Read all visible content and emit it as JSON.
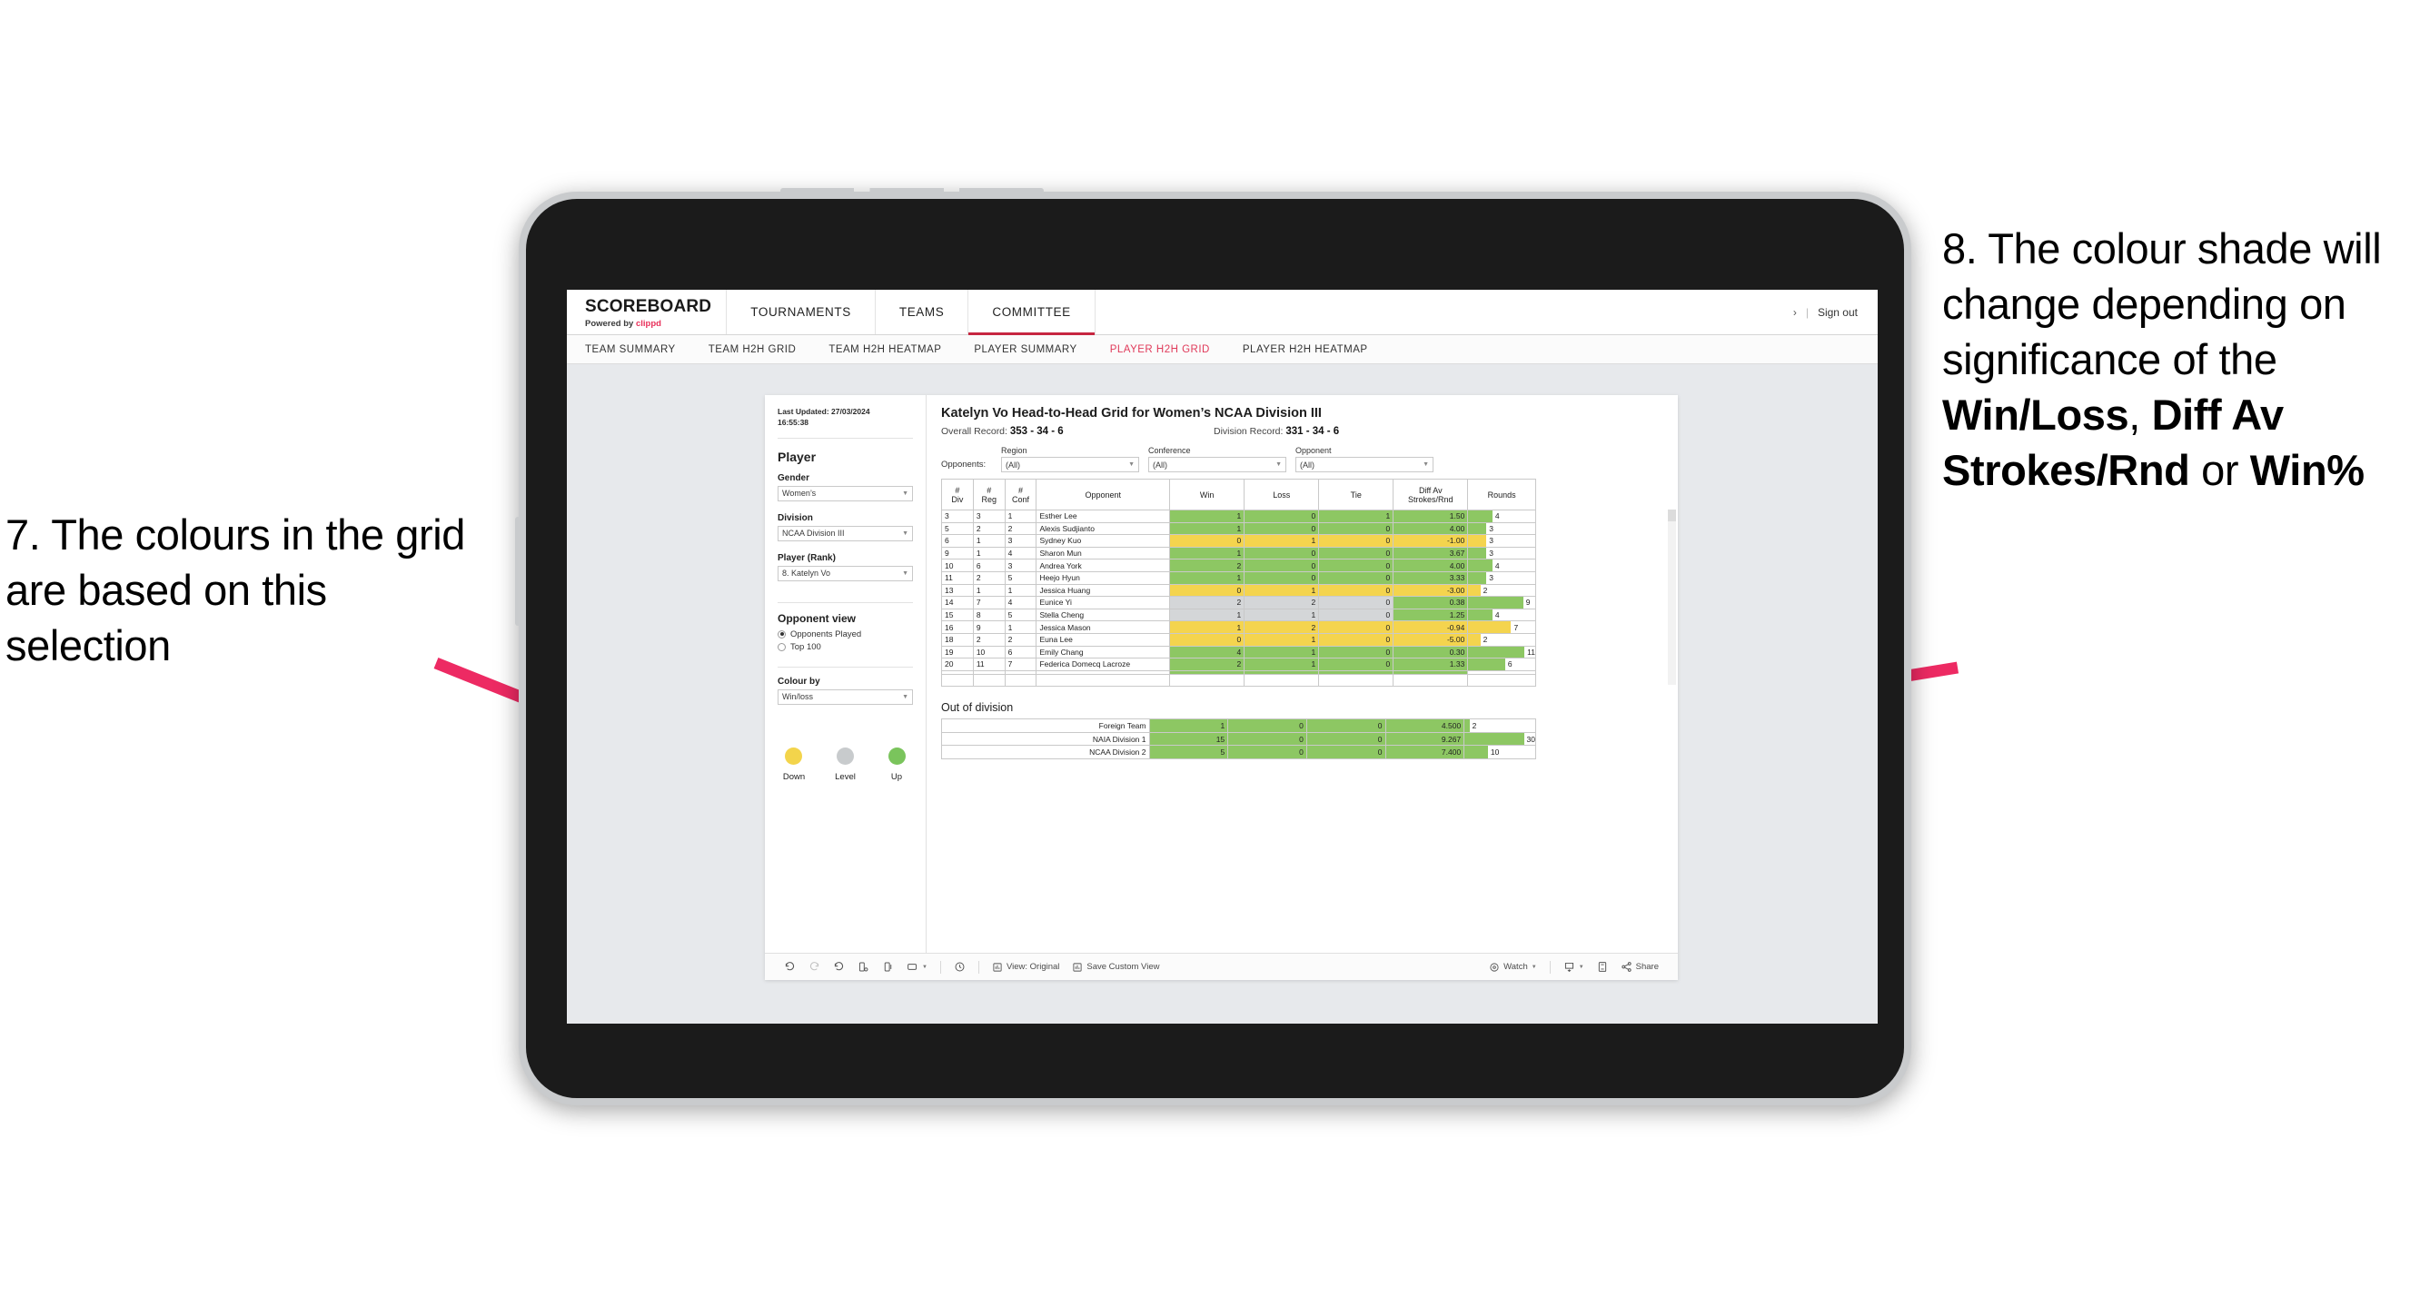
{
  "annotations": {
    "left": {
      "id": "7.",
      "text": "7. The colours in the grid are based on this selection"
    },
    "right": {
      "id": "8.",
      "line1": "8. The colour shade will change depending on significance of the ",
      "bold1": "Win/Loss",
      "mid1": ", ",
      "bold2": "Diff Av Strokes/Rnd",
      "mid2": " or ",
      "bold3": "Win%"
    },
    "arrow_color": "#ed2a63"
  },
  "app": {
    "brand": {
      "title": "SCOREBOARD",
      "powered_prefix": "Powered by ",
      "powered_name": "clippd"
    },
    "top_nav": [
      {
        "label": "TOURNAMENTS",
        "active": false
      },
      {
        "label": "TEAMS",
        "active": false
      },
      {
        "label": "COMMITTEE",
        "active": true
      }
    ],
    "top_right": {
      "chevron": "›",
      "separator": "|",
      "sign_out": "Sign out"
    },
    "sub_nav": [
      {
        "label": "TEAM SUMMARY",
        "active": false
      },
      {
        "label": "TEAM H2H GRID",
        "active": false
      },
      {
        "label": "TEAM H2H HEATMAP",
        "active": false
      },
      {
        "label": "PLAYER SUMMARY",
        "active": false
      },
      {
        "label": "PLAYER H2H GRID",
        "active": true
      },
      {
        "label": "PLAYER H2H HEATMAP",
        "active": false
      }
    ],
    "accent_color": "#e03a5a"
  },
  "pane": {
    "last_updated": "Last Updated: 27/03/2024\n16:55:38",
    "heading": "Player",
    "gender": {
      "label": "Gender",
      "value": "Women’s"
    },
    "division": {
      "label": "Division",
      "value": "NCAA Division III"
    },
    "player_rank": {
      "label": "Player (Rank)",
      "value": "8. Katelyn Vo"
    },
    "opponent_view": {
      "heading": "Opponent view",
      "options": [
        {
          "label": "Opponents Played",
          "selected": true
        },
        {
          "label": "Top 100",
          "selected": false
        }
      ]
    },
    "colour_by": {
      "label": "Colour by",
      "value": "Win/loss"
    },
    "legend": {
      "items": [
        {
          "label": "Down",
          "color": "#f3d44b"
        },
        {
          "label": "Level",
          "color": "#c8cbcd"
        },
        {
          "label": "Up",
          "color": "#7ac45c"
        }
      ]
    }
  },
  "main": {
    "title": "Katelyn Vo Head-to-Head Grid for Women’s NCAA Division III",
    "overall_record_label": "Overall Record: ",
    "overall_record_value": "353 - 34 - 6",
    "division_record_label": "Division Record: ",
    "division_record_value": "331 - 34 - 6",
    "opponents_label": "Opponents:",
    "filters": [
      {
        "label": "Region",
        "value": "(All)"
      },
      {
        "label": "Conference",
        "value": "(All)"
      },
      {
        "label": "Opponent",
        "value": "(All)"
      }
    ]
  },
  "chart_data": {
    "type": "table",
    "title": "Katelyn Vo Head-to-Head Grid for Women’s NCAA Division III",
    "columns": [
      "# Div",
      "# Reg",
      "# Conf",
      "Opponent",
      "Win",
      "Loss",
      "Tie",
      "Diff Av Strokes/Rnd",
      "Rounds"
    ],
    "column_headers_multiline": [
      [
        "#",
        "Div"
      ],
      [
        "#",
        "Reg"
      ],
      [
        "#",
        "Conf"
      ],
      [
        "Opponent"
      ],
      [
        "Win"
      ],
      [
        "Loss"
      ],
      [
        "Tie"
      ],
      [
        "Diff Av",
        "Strokes/Rnd"
      ],
      [
        "Rounds"
      ]
    ],
    "colors": {
      "up": "#8dc763",
      "down": "#f4d44e",
      "level": "#d4d6d8",
      "rounds_max": 11
    },
    "rows": [
      {
        "div": "3",
        "reg": "3",
        "conf": "1",
        "opponent": "Esther Lee",
        "win": "1",
        "loss": "0",
        "tie": "1",
        "diff": "1.50",
        "rounds": 4,
        "shade": "up"
      },
      {
        "div": "5",
        "reg": "2",
        "conf": "2",
        "opponent": "Alexis Sudjianto",
        "win": "1",
        "loss": "0",
        "tie": "0",
        "diff": "4.00",
        "rounds": 3,
        "shade": "up"
      },
      {
        "div": "6",
        "reg": "1",
        "conf": "3",
        "opponent": "Sydney Kuo",
        "win": "0",
        "loss": "1",
        "tie": "0",
        "diff": "-1.00",
        "rounds": 3,
        "shade": "down"
      },
      {
        "div": "9",
        "reg": "1",
        "conf": "4",
        "opponent": "Sharon Mun",
        "win": "1",
        "loss": "0",
        "tie": "0",
        "diff": "3.67",
        "rounds": 3,
        "shade": "up"
      },
      {
        "div": "10",
        "reg": "6",
        "conf": "3",
        "opponent": "Andrea York",
        "win": "2",
        "loss": "0",
        "tie": "0",
        "diff": "4.00",
        "rounds": 4,
        "shade": "up"
      },
      {
        "div": "11",
        "reg": "2",
        "conf": "5",
        "opponent": "Heejo Hyun",
        "win": "1",
        "loss": "0",
        "tie": "0",
        "diff": "3.33",
        "rounds": 3,
        "shade": "up"
      },
      {
        "div": "13",
        "reg": "1",
        "conf": "1",
        "opponent": "Jessica Huang",
        "win": "0",
        "loss": "1",
        "tie": "0",
        "diff": "-3.00",
        "rounds": 2,
        "shade": "down"
      },
      {
        "div": "14",
        "reg": "7",
        "conf": "4",
        "opponent": "Eunice Yi",
        "win": "2",
        "loss": "2",
        "tie": "0",
        "diff": "0.38",
        "rounds": 9,
        "shade": "level",
        "diff_shade": "up"
      },
      {
        "div": "15",
        "reg": "8",
        "conf": "5",
        "opponent": "Stella Cheng",
        "win": "1",
        "loss": "1",
        "tie": "0",
        "diff": "1.25",
        "rounds": 4,
        "shade": "level",
        "diff_shade": "up"
      },
      {
        "div": "16",
        "reg": "9",
        "conf": "1",
        "opponent": "Jessica Mason",
        "win": "1",
        "loss": "2",
        "tie": "0",
        "diff": "-0.94",
        "rounds": 7,
        "shade": "down"
      },
      {
        "div": "18",
        "reg": "2",
        "conf": "2",
        "opponent": "Euna Lee",
        "win": "0",
        "loss": "1",
        "tie": "0",
        "diff": "-5.00",
        "rounds": 2,
        "shade": "down"
      },
      {
        "div": "19",
        "reg": "10",
        "conf": "6",
        "opponent": "Emily Chang",
        "win": "4",
        "loss": "1",
        "tie": "0",
        "diff": "0.30",
        "rounds": 11,
        "shade": "up"
      },
      {
        "div": "20",
        "reg": "11",
        "conf": "7",
        "opponent": "Federica Domecq Lacroze",
        "win": "2",
        "loss": "1",
        "tie": "0",
        "diff": "1.33",
        "rounds": 6,
        "shade": "up"
      }
    ],
    "out_of_division": {
      "title": "Out of division",
      "rows": [
        {
          "opponent": "Foreign Team",
          "win": "1",
          "loss": "0",
          "tie": "0",
          "diff": "4.500",
          "rounds": 2,
          "shade": "up"
        },
        {
          "opponent": "NAIA Division 1",
          "win": "15",
          "loss": "0",
          "tie": "0",
          "diff": "9.267",
          "rounds": 30,
          "shade": "up"
        },
        {
          "opponent": "NCAA Division 2",
          "win": "5",
          "loss": "0",
          "tie": "0",
          "diff": "7.400",
          "rounds": 10,
          "shade": "up"
        }
      ],
      "rounds_max": 30
    }
  },
  "toolbar": {
    "view_label": "View: Original",
    "save_label": "Save Custom View",
    "watch_label": "Watch",
    "share_label": "Share"
  }
}
